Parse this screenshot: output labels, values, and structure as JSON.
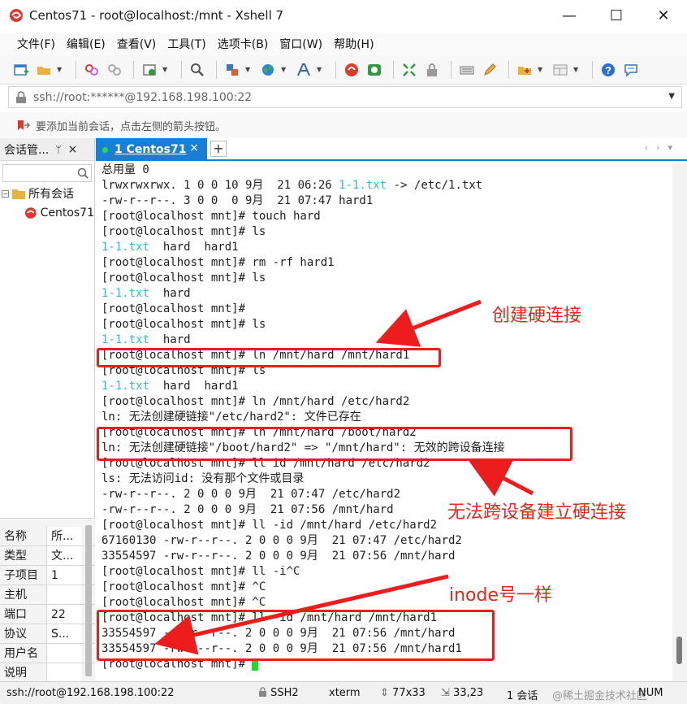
{
  "window": {
    "title": "Centos71 - root@localhost:/mnt - Xshell 7",
    "controls": [
      "—",
      "☐",
      "✕"
    ]
  },
  "menu": [
    "文件(F)",
    "编辑(E)",
    "查看(V)",
    "工具(T)",
    "选项卡(B)",
    "窗口(W)",
    "帮助(H)"
  ],
  "toolbar_icons": [
    "new-session-icon",
    "open-folder-icon",
    "link-icon",
    "unlink-icon",
    "properties-icon",
    "search-icon",
    "transfer-icon",
    "globe-icon",
    "font-icon",
    "xshell-icon",
    "xftp-icon",
    "fullscreen-icon",
    "lock-icon",
    "keyboard-icon",
    "pen-icon",
    "compose-icon",
    "layout-icon",
    "help-icon",
    "chat-icon"
  ],
  "address": {
    "value": "ssh://root:******@192.168.198.100:22"
  },
  "hint": {
    "text": "要添加当前会话，点击左侧的箭头按钮。"
  },
  "sidebar": {
    "title": "会话管...",
    "pin": "ᛘ",
    "close": "×",
    "tree_root": "所有会话",
    "tree_child": "Centos71"
  },
  "properties": [
    {
      "key": "名称",
      "value": "所..."
    },
    {
      "key": "类型",
      "value": "文..."
    },
    {
      "key": "子项目",
      "value": "1"
    },
    {
      "key": "主机",
      "value": ""
    },
    {
      "key": "端口",
      "value": "22"
    },
    {
      "key": "协议",
      "value": "S..."
    },
    {
      "key": "用户名",
      "value": ""
    },
    {
      "key": "说明",
      "value": ""
    }
  ],
  "tab": {
    "label": "1 Centos71",
    "close": "×",
    "add": "+",
    "nav": "‹›▾"
  },
  "terminal": {
    "lines": [
      {
        "text": "总用量 0"
      },
      {
        "parts": [
          {
            "t": "lrwxrwxrwx. 1 0 0 10 9月  21 06:26 "
          },
          {
            "t": "1-1.txt",
            "c": "cyan"
          },
          {
            "t": " -> /etc/1.txt"
          }
        ]
      },
      {
        "text": "-rw-r--r--. 3 0 0  0 9月  21 07:47 hard1"
      },
      {
        "text": "[root@localhost mnt]# touch hard"
      },
      {
        "text": "[root@localhost mnt]# ls"
      },
      {
        "parts": [
          {
            "t": "1-1.txt",
            "c": "cyan"
          },
          {
            "t": "  hard  hard1"
          }
        ]
      },
      {
        "text": "[root@localhost mnt]# rm -rf hard1"
      },
      {
        "text": "[root@localhost mnt]# ls"
      },
      {
        "parts": [
          {
            "t": "1-1.txt",
            "c": "cyan"
          },
          {
            "t": "  hard"
          }
        ]
      },
      {
        "text": "[root@localhost mnt]#"
      },
      {
        "text": "[root@localhost mnt]# ls"
      },
      {
        "parts": [
          {
            "t": "1-1.txt",
            "c": "cyan"
          },
          {
            "t": "  hard"
          }
        ]
      },
      {
        "text": "[root@localhost mnt]# ln /mnt/hard /mnt/hard1"
      },
      {
        "text": "[root@localhost mnt]# ls"
      },
      {
        "parts": [
          {
            "t": "1-1.txt",
            "c": "cyan"
          },
          {
            "t": "  hard  hard1"
          }
        ]
      },
      {
        "text": "[root@localhost mnt]# ln /mnt/hard /etc/hard2"
      },
      {
        "text": "ln: 无法创建硬链接\"/etc/hard2\": 文件已存在"
      },
      {
        "text": "[root@localhost mnt]# ln /mnt/hard /boot/hard2"
      },
      {
        "text": "ln: 无法创建硬链接\"/boot/hard2\" => \"/mnt/hard\": 无效的跨设备连接"
      },
      {
        "text": "[root@localhost mnt]# ll id /mnt/hard /etc/hard2"
      },
      {
        "text": "ls: 无法访问id: 没有那个文件或目录"
      },
      {
        "text": "-rw-r--r--. 2 0 0 0 9月  21 07:47 /etc/hard2"
      },
      {
        "text": "-rw-r--r--. 2 0 0 0 9月  21 07:56 /mnt/hard"
      },
      {
        "text": "[root@localhost mnt]# ll -id /mnt/hard /etc/hard2"
      },
      {
        "text": "67160130 -rw-r--r--. 2 0 0 0 9月  21 07:47 /etc/hard2"
      },
      {
        "text": "33554597 -rw-r--r--. 2 0 0 0 9月  21 07:56 /mnt/hard"
      },
      {
        "text": "[root@localhost mnt]# ll -i^C"
      },
      {
        "text": "[root@localhost mnt]# ^C"
      },
      {
        "text": "[root@localhost mnt]# ^C"
      },
      {
        "text": "[root@localhost mnt]# ll -id /mnt/hard /mnt/hard1"
      },
      {
        "text": "33554597 -rw-r--r--. 2 0 0 0 9月  21 07:56 /mnt/hard"
      },
      {
        "text": "33554597 -rw-r--r--. 2 0 0 0 9月  21 07:56 /mnt/hard1"
      },
      {
        "text": "[root@localhost mnt]# ",
        "cursor": true
      }
    ]
  },
  "annotations": {
    "create_hardlink": "创建硬连接",
    "cross_device": "无法跨设备建立硬连接",
    "same_inode": "inode号一样",
    "color": "#e8261c"
  },
  "status": {
    "connection": "ssh://root@192.168.198.100:22",
    "protocol": "SSH2",
    "terminal_type": "xterm",
    "size": "77x33",
    "cursor_pos": "33,23",
    "sessions": "1 会话",
    "watermark": "@稀土掘金技术社区",
    "num": "NUM"
  },
  "colors": {
    "accent": "#1a7fd4",
    "terminal_cyan": "#35b7d6",
    "cursor": "#22dd22",
    "highlight": "#ee1d1d"
  }
}
